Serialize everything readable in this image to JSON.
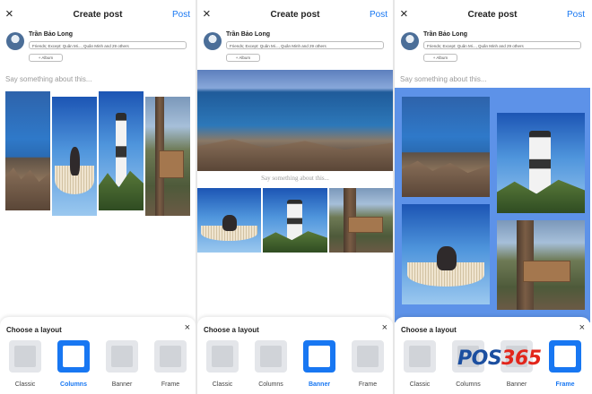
{
  "header": {
    "close_icon": "×",
    "title": "Create post",
    "post_label": "Post"
  },
  "user": {
    "name": "Trần Bảo Long",
    "audience": "Friends; Except: Quân Mi..., Quân Minh and 29 others",
    "album": "+ Album"
  },
  "composer": {
    "placeholder": "Say something about this..."
  },
  "layouts": {
    "title": "Choose a layout",
    "close_icon": "×",
    "options": [
      "Classic",
      "Columns",
      "Banner",
      "Frame"
    ]
  },
  "panels": [
    {
      "active_layout": "Columns"
    },
    {
      "active_layout": "Banner"
    },
    {
      "active_layout": "Frame"
    }
  ],
  "watermark": {
    "prefix": "POS",
    "number": "365"
  },
  "colors": {
    "accent": "#1877f2",
    "frame_background": "#5d92e8"
  }
}
